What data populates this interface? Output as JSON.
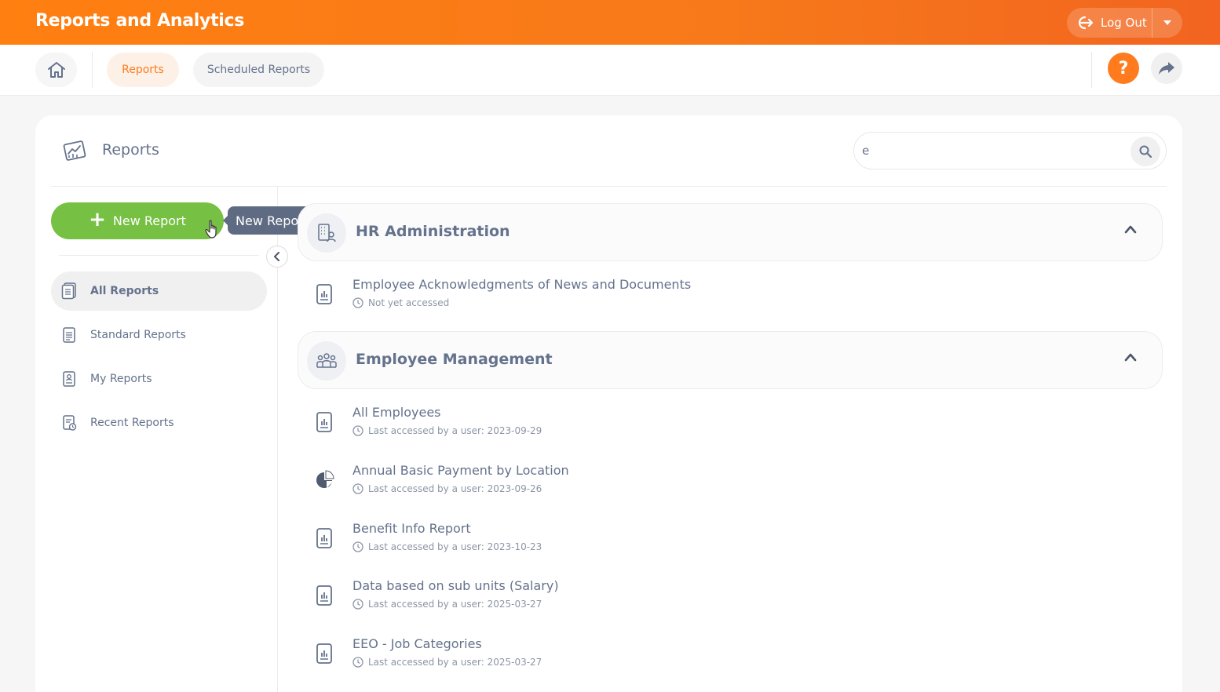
{
  "header": {
    "app_title": "Reports and Analytics",
    "logout_label": "Log Out"
  },
  "nav": {
    "tabs": [
      {
        "label": "Reports",
        "active": true
      },
      {
        "label": "Scheduled Reports",
        "active": false
      }
    ],
    "help_label": "?"
  },
  "panel": {
    "title": "Reports",
    "search_value": "e"
  },
  "sidebar": {
    "new_report_label": "New Report",
    "tooltip": "New Report",
    "items": [
      {
        "label": "All Reports",
        "active": true
      },
      {
        "label": "Standard Reports",
        "active": false
      },
      {
        "label": "My Reports",
        "active": false
      },
      {
        "label": "Recent Reports",
        "active": false
      }
    ]
  },
  "groups": [
    {
      "title": "HR Administration",
      "reports": [
        {
          "name": "Employee Acknowledgments of News and Documents",
          "meta": "Not yet accessed",
          "icon": "report-doc-icon"
        }
      ]
    },
    {
      "title": "Employee Management",
      "reports": [
        {
          "name": "All Employees",
          "meta": "Last accessed by a user: 2023-09-29",
          "icon": "report-doc-icon"
        },
        {
          "name": "Annual Basic Payment by Location",
          "meta": "Last accessed by a user: 2023-09-26",
          "icon": "pie-chart-icon"
        },
        {
          "name": "Benefit Info Report",
          "meta": "Last accessed by a user: 2023-10-23",
          "icon": "report-doc-icon"
        },
        {
          "name": "Data based on sub units (Salary)",
          "meta": "Last accessed by a user: 2025-03-27",
          "icon": "report-doc-icon"
        },
        {
          "name": "EEO - Job Categories",
          "meta": "Last accessed by a user: 2025-03-27",
          "icon": "report-doc-icon"
        }
      ]
    }
  ],
  "colors": {
    "brand_orange": "#ff7b1d",
    "green": "#76c043",
    "text": "#64728c"
  }
}
